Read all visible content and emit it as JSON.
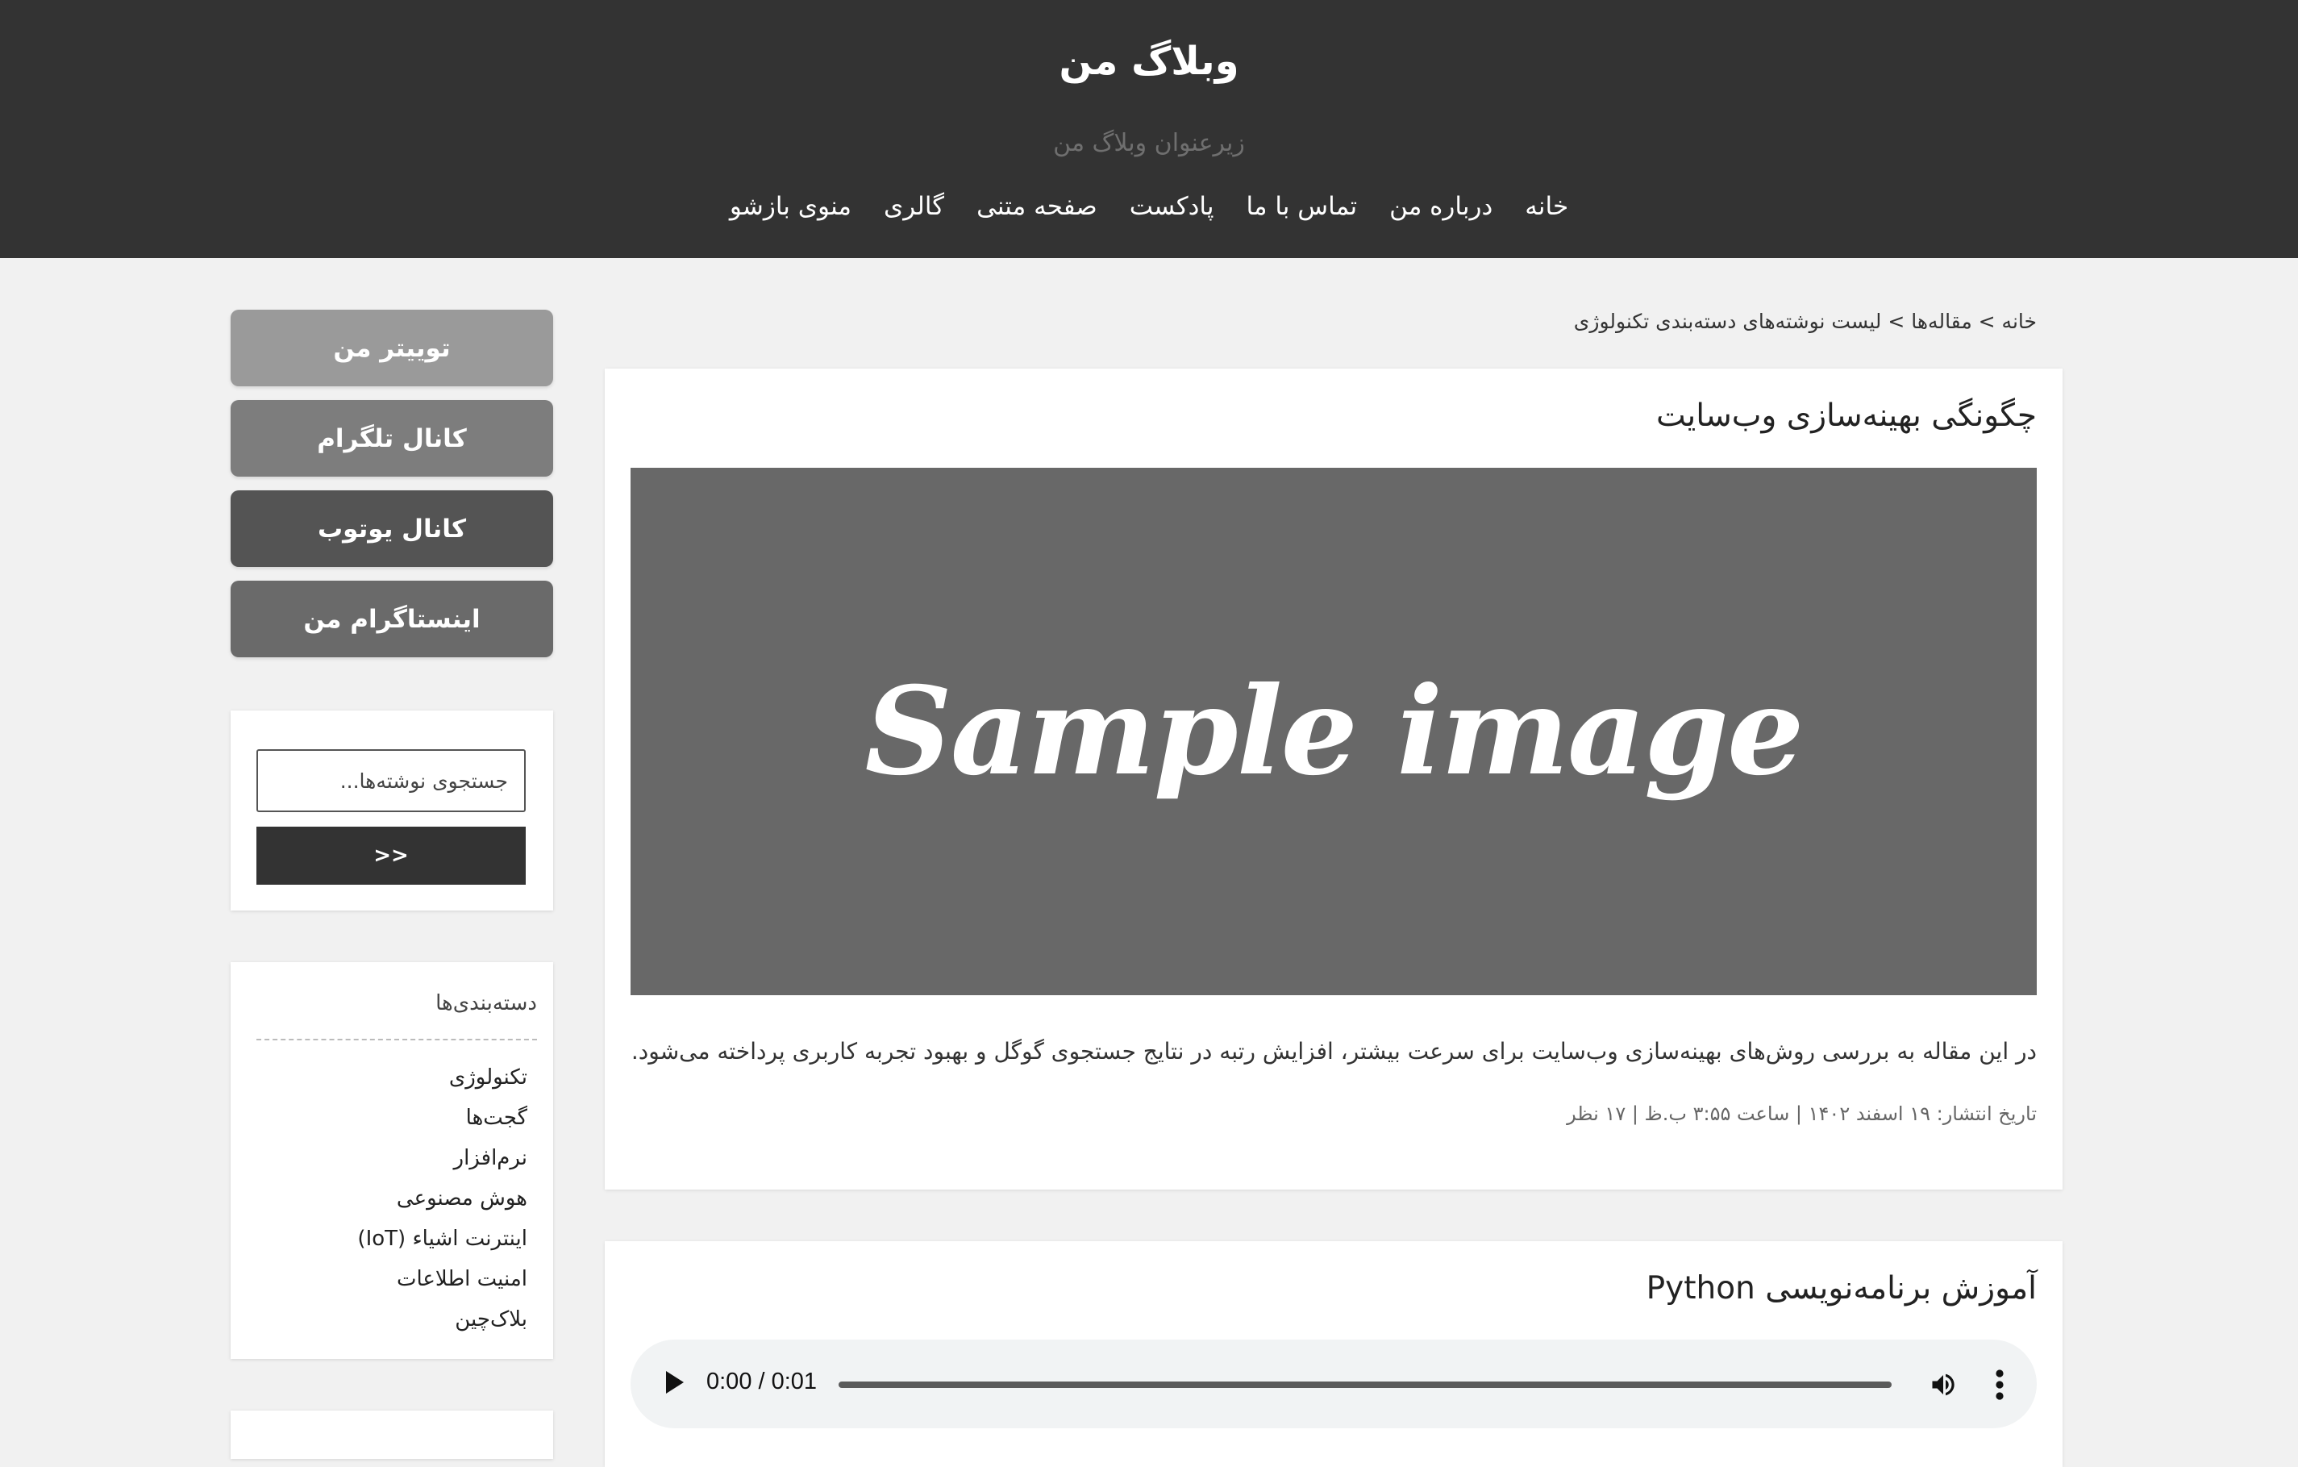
{
  "header": {
    "title": "وبلاگ من",
    "subtitle": "زیرعنوان وبلاگ من",
    "nav": [
      "خانه",
      "درباره من",
      "تماس با ما",
      "پادکست",
      "صفحه متنی",
      "گالری",
      "منوی بازشو"
    ]
  },
  "sidebar": {
    "social": [
      {
        "label": "توییتر من",
        "color": "#9a9a9a"
      },
      {
        "label": "کانال تلگرام",
        "color": "#7d7d7d"
      },
      {
        "label": "کانال یوتوب",
        "color": "#545454"
      },
      {
        "label": "اینستاگرام من",
        "color": "#6a6a6a"
      }
    ],
    "search": {
      "placeholder": "جستجوی نوشته‌ها...",
      "button_label": ">>"
    },
    "categories": {
      "title": "دسته‌بندی‌ها",
      "items": [
        "تکنولوژی",
        "گجت‌ها",
        "نرم‌افزار",
        "هوش مصنوعی",
        "اینترنت اشیاء (IoT)",
        "امنیت اطلاعات",
        "بلاک‌چین"
      ]
    }
  },
  "breadcrumb": "خانه > مقاله‌ها > لیست نوشته‌های دسته‌بندی تکنولوژی",
  "posts": [
    {
      "title": "چگونگی بهینه‌سازی وب‌سایت",
      "image_text": "Sample image",
      "excerpt": "در این مقاله به بررسی روش‌های بهینه‌سازی وب‌سایت برای سرعت بیشتر، افزایش رتبه در نتایج جستجوی گوگل و بهبود تجربه کاربری پرداخته می‌شود.",
      "meta": "تاریخ انتشار: ۱۹ اسفند ۱۴۰۲ | ساعت ۳:۵۵ ب.ظ | ۱۷ نظر"
    },
    {
      "title": "آموزش برنامه‌نویسی Python",
      "audio_time": "0:00 / 0:01"
    }
  ]
}
